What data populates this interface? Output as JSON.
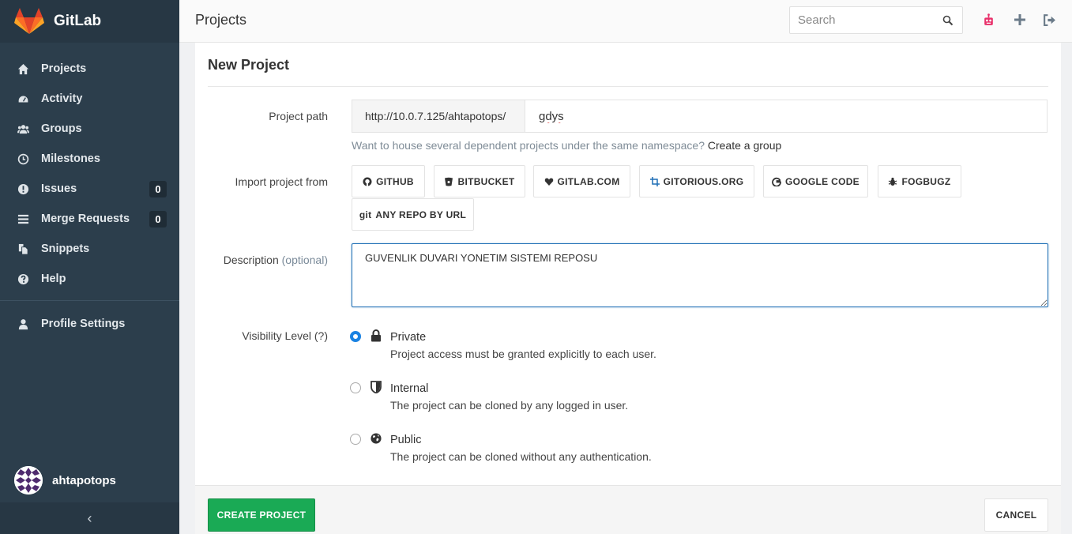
{
  "brand": {
    "name": "GitLab"
  },
  "sidebar": {
    "items": [
      {
        "label": "Projects",
        "icon": "home-icon"
      },
      {
        "label": "Activity",
        "icon": "dashboard-icon"
      },
      {
        "label": "Groups",
        "icon": "group-icon"
      },
      {
        "label": "Milestones",
        "icon": "clock-icon"
      },
      {
        "label": "Issues",
        "icon": "exclamation-icon",
        "count": "0"
      },
      {
        "label": "Merge Requests",
        "icon": "list-icon",
        "count": "0"
      },
      {
        "label": "Snippets",
        "icon": "files-icon"
      },
      {
        "label": "Help",
        "icon": "question-icon"
      }
    ],
    "profile": {
      "label": "Profile Settings",
      "icon": "user-icon"
    },
    "user": {
      "name": "ahtapotops"
    },
    "collapse_glyph": "‹"
  },
  "topbar": {
    "title": "Projects",
    "search_placeholder": "Search"
  },
  "form": {
    "heading": "New Project",
    "path_label": "Project path",
    "path_prefix": "http://10.0.7.125/ahtapotops/",
    "path_value": "gdys",
    "help_text": "Want to house several dependent projects under the same namespace?",
    "help_link": "Create a group",
    "import_label": "Import project from",
    "import_buttons": [
      "GITHUB",
      "BITBUCKET",
      "GITLAB.COM",
      "GITORIOUS.ORG",
      "GOOGLE CODE",
      "FOGBUGZ",
      "ANY REPO BY URL"
    ],
    "git_glyph": "git",
    "description_label": "Description",
    "description_optional": "(optional)",
    "description_value": "GUVENLIK DUVARI YONETIM SISTEMI REPOSU",
    "visibility_label": "Visibility Level (?)",
    "visibility_options": [
      {
        "title": "Private",
        "desc": "Project access must be granted explicitly to each user.",
        "selected": true,
        "icon": "lock-icon"
      },
      {
        "title": "Internal",
        "desc": "The project can be cloned by any logged in user.",
        "selected": false,
        "icon": "shield-icon"
      },
      {
        "title": "Public",
        "desc": "The project can be cloned without any authentication.",
        "selected": false,
        "icon": "globe-icon"
      }
    ]
  },
  "footer": {
    "create_label": "CREATE PROJECT",
    "cancel_label": "CANCEL"
  },
  "colors": {
    "sidebar": "#2c3e4c",
    "accent_green": "#1aaa55",
    "focus_blue": "#1f6fb5",
    "alert_red": "#e8306a"
  }
}
